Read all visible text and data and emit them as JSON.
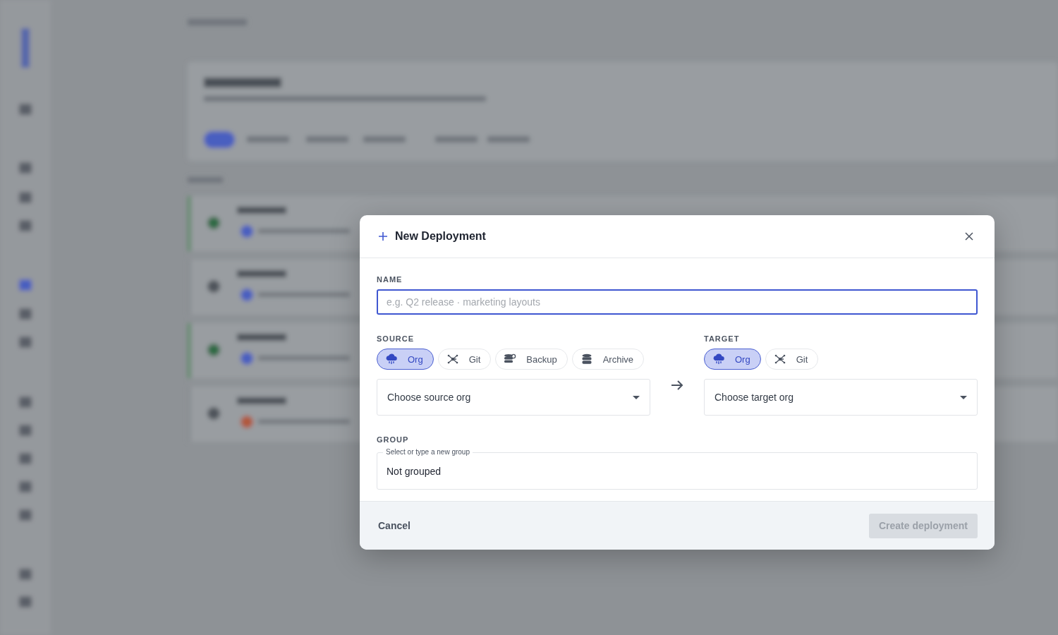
{
  "dialog": {
    "title": "New Deployment"
  },
  "name_field": {
    "label": "NAME",
    "placeholder": "e.g. Q2 release · marketing layouts",
    "focused": true
  },
  "source": {
    "label": "SOURCE",
    "options": [
      {
        "label": "Org",
        "kind": "org",
        "selected": true
      },
      {
        "label": "Git",
        "kind": "git",
        "selected": false
      },
      {
        "label": "Backup",
        "kind": "backup",
        "selected": false
      },
      {
        "label": "Archive",
        "kind": "archive",
        "selected": false
      }
    ],
    "select": {
      "placeholder": "Choose source org"
    }
  },
  "target": {
    "label": "TARGET",
    "options": [
      {
        "label": "Org",
        "kind": "org",
        "selected": true
      },
      {
        "label": "Git",
        "kind": "git",
        "selected": false
      }
    ],
    "select": {
      "placeholder": "Choose target org"
    }
  },
  "group": {
    "label": "GROUP",
    "floating_label": "Select or type a new group",
    "value": "Not grouped"
  },
  "footer": {
    "cancel": "Cancel",
    "create": {
      "label": "Create deployment",
      "disabled": true
    }
  }
}
